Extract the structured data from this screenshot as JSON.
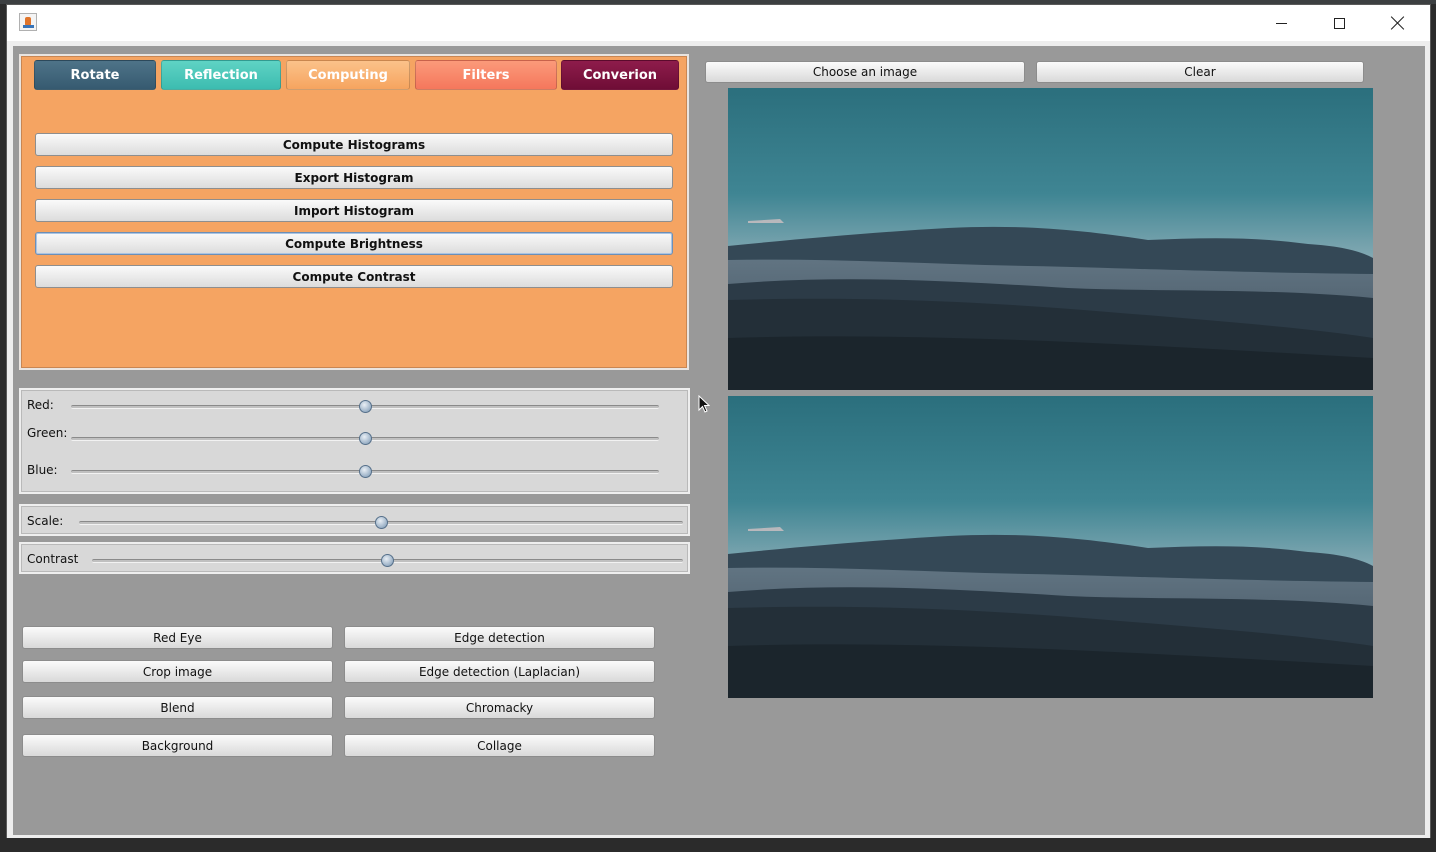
{
  "window": {
    "title": ""
  },
  "tabs": [
    {
      "label": "Rotate"
    },
    {
      "label": "Reflection"
    },
    {
      "label": "Computing"
    },
    {
      "label": "Filters"
    },
    {
      "label": "Converion"
    }
  ],
  "computing_actions": [
    {
      "label": "Compute Histograms"
    },
    {
      "label": "Export Histogram"
    },
    {
      "label": "Import Histogram"
    },
    {
      "label": "Compute Brightness"
    },
    {
      "label": "Compute Contrast"
    }
  ],
  "sliders": {
    "red": {
      "label": "Red:",
      "value": 0.5
    },
    "green": {
      "label": "Green:",
      "value": 0.5
    },
    "blue": {
      "label": "Blue:",
      "value": 0.5
    },
    "scale": {
      "label": "Scale:",
      "value": 0.5
    },
    "contrast": {
      "label": "Contrast",
      "value": 0.5
    }
  },
  "tools": [
    {
      "label": "Red Eye"
    },
    {
      "label": "Edge detection"
    },
    {
      "label": "Crop image"
    },
    {
      "label": "Edge detection (Laplacian)"
    },
    {
      "label": "Blend"
    },
    {
      "label": "Chromacky"
    },
    {
      "label": "Background"
    },
    {
      "label": "Collage"
    }
  ],
  "image_controls": {
    "choose_label": "Choose an image",
    "clear_label": "Clear"
  },
  "colors": {
    "panel_orange": "#f5a462",
    "client_gray": "#999999",
    "tab_rotate": "#3f6479",
    "tab_reflection": "#48c6b8",
    "tab_computing": "#f8b070",
    "tab_filters": "#f7866a",
    "tab_conversion": "#7b1240"
  },
  "icons": {
    "app": "java-icon",
    "minimize": "minimize-icon",
    "maximize": "maximize-icon",
    "close": "close-icon"
  }
}
